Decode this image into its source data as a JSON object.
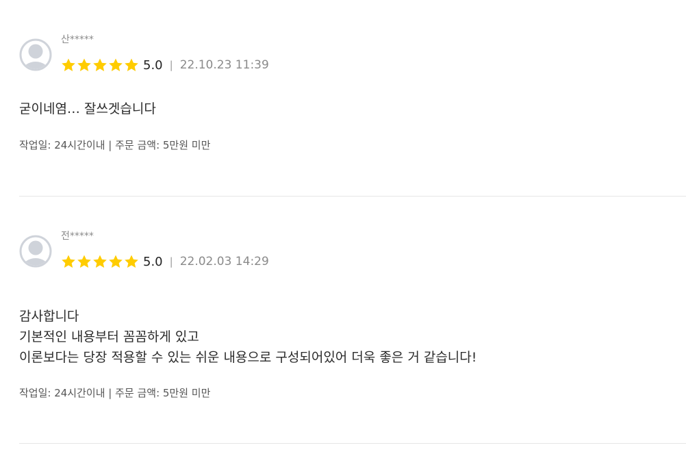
{
  "reviews": [
    {
      "username": "산*****",
      "score": "5.0",
      "stars": 5,
      "separator": "|",
      "datetime": "22.10.23 11:39",
      "body": [
        "굳이네염… 잘쓰겟습니다"
      ],
      "meta": "작업일: 24시간이내 | 주문 금액: 5만원 미만"
    },
    {
      "username": "전*****",
      "score": "5.0",
      "stars": 5,
      "separator": "|",
      "datetime": "22.02.03 14:29",
      "body": [
        "감사합니다",
        "기본적인 내용부터 꼼꼼하게 있고",
        "이론보다는 당장 적용할 수 있는 쉬운 내용으로 구성되어있어 더욱 좋은 거 같습니다!"
      ],
      "meta": "작업일: 24시간이내 | 주문 금액: 5만원 미만"
    }
  ],
  "icons": {
    "avatar": "user-avatar-icon",
    "star": "star-icon"
  },
  "colors": {
    "star": "#FFCC00",
    "avatar_ring": "#CFD3DA",
    "divider": "#E6E6E6"
  }
}
